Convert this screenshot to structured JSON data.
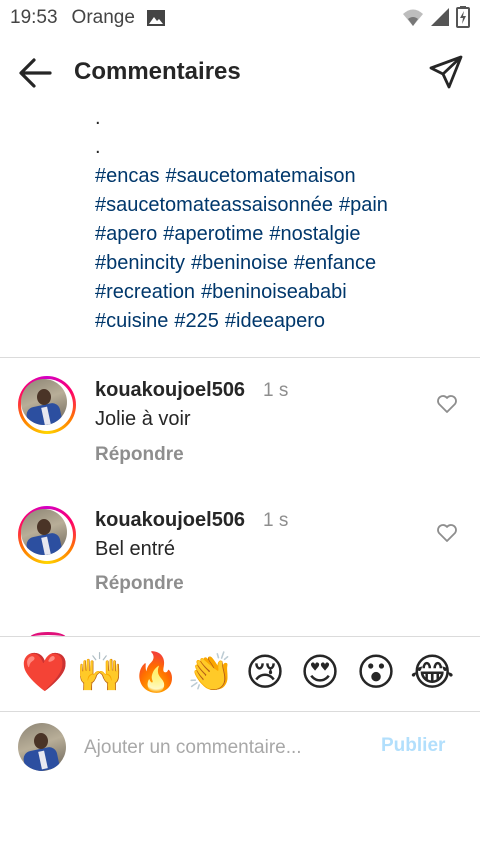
{
  "status_bar": {
    "time": "19:53",
    "carrier": "Orange"
  },
  "header": {
    "title": "Commentaires",
    "back_icon": "arrow-left-icon",
    "send_icon": "paper-plane-icon"
  },
  "caption": {
    "dots": [
      ".",
      "."
    ],
    "hashtags": [
      "#encas",
      "#saucetomatemaison",
      "#saucetomateassaisonnée",
      "#pain",
      "#apero",
      "#aperotime",
      "#nostalgie",
      "#benincity",
      "#beninoise",
      "#enfance",
      "#recreation",
      "#beninoiseababi",
      "#cuisine",
      "#225",
      "#ideeapero"
    ],
    "hashtag_color": "#00376b"
  },
  "comments": [
    {
      "username": "kouakoujoel506",
      "time": "1 s",
      "text": "Jolie à voir",
      "reply_label": "Répondre"
    },
    {
      "username": "kouakoujoel506",
      "time": "1 s",
      "text": "Bel entré",
      "reply_label": "Répondre"
    }
  ],
  "emoji_bar": [
    {
      "icon": "red-heart-emoji",
      "char": "❤️"
    },
    {
      "icon": "raising-hands-emoji",
      "char": "🙌"
    },
    {
      "icon": "fire-emoji",
      "char": "🔥"
    },
    {
      "icon": "clapping-hands-emoji",
      "char": "👏"
    },
    {
      "icon": "crying-face-emoji",
      "char": "😢"
    },
    {
      "icon": "heart-eyes-emoji",
      "char": "😍"
    },
    {
      "icon": "surprised-face-emoji",
      "char": "😮"
    },
    {
      "icon": "tears-of-joy-emoji",
      "char": "😂"
    }
  ],
  "compose": {
    "placeholder": "Ajouter un commentaire...",
    "publish_label": "Publier",
    "publish_color": "#b2dffc"
  },
  "colors": {
    "text_primary": "#262626",
    "text_secondary": "#8e8e8e",
    "divider": "#dbdbdb"
  }
}
